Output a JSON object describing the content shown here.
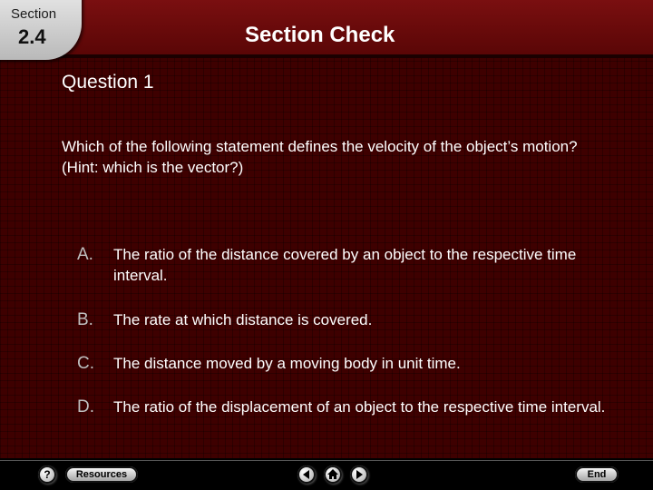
{
  "header": {
    "section_label": "Section",
    "section_number": "2.4",
    "title": "Section Check"
  },
  "question": {
    "title": "Question 1",
    "text": "Which of the following statement defines the velocity of the object’s motion? (Hint: which is the vector?)"
  },
  "options": [
    {
      "letter": "A.",
      "text": "The ratio of the distance covered by an object to the respective time interval."
    },
    {
      "letter": "B.",
      "text": "The rate at which distance is covered."
    },
    {
      "letter": "C.",
      "text": "The distance moved by a moving body in unit time."
    },
    {
      "letter": "D.",
      "text": "The ratio of the displacement of an object to the respective time interval."
    }
  ],
  "footer": {
    "help_label": "?",
    "resources_label": "Resources",
    "end_label": "End",
    "icons": [
      "prev-arrow-icon",
      "home-icon",
      "next-arrow-icon"
    ]
  },
  "colors": {
    "background": "#3e0000",
    "header": "#7a0f10",
    "text": "#ffffff",
    "option_letter": "#bfbfbf"
  }
}
